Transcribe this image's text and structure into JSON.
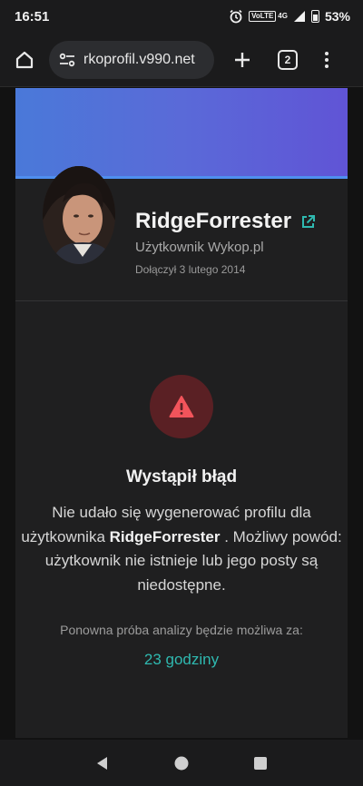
{
  "status_bar": {
    "time": "16:51",
    "network": "4G",
    "volte": "VoLTE",
    "battery": "53%"
  },
  "browser": {
    "url": "rkoprofil.v990.net",
    "tab_count": "2",
    "icons": [
      "home-icon",
      "site-settings-icon",
      "new-tab-icon",
      "tab-switcher-icon",
      "more-menu-icon"
    ]
  },
  "profile": {
    "username": "RidgeForrester",
    "subtitle": "Użytkownik Wykop.pl",
    "joined": "Dołączył 3 lutego 2014"
  },
  "error": {
    "title": "Wystąpił błąd",
    "message_part1": "Nie udało się wygenerować profilu dla użytkownika ",
    "message_user": "RidgeForrester",
    "message_part2": " . Możliwy powód: użytkownik nie istnieje lub jego posty są niedostępne.",
    "retry_label": "Ponowna próba analizy będzie możliwa za:",
    "retry_time": "23 godziny"
  },
  "colors": {
    "accent_teal": "#2fb9b0",
    "error_red": "#f2545b",
    "banner_start": "#4a79d9",
    "banner_end": "#6054d6"
  }
}
